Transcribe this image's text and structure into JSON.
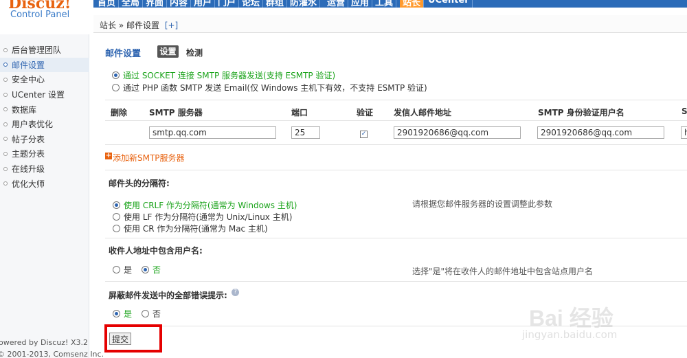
{
  "logo": {
    "brand": "Discuz!",
    "subtitle": "Control Panel"
  },
  "topnav": [
    {
      "label": "首页"
    },
    {
      "label": "全局"
    },
    {
      "label": "界面"
    },
    {
      "label": "内容"
    },
    {
      "label": "用户"
    },
    {
      "label": "门户"
    },
    {
      "label": "论坛"
    },
    {
      "label": "群组"
    },
    {
      "label": "防灌水"
    },
    {
      "label": "运营"
    },
    {
      "label": "应用"
    },
    {
      "label": "工具"
    },
    {
      "label": "站长"
    },
    {
      "label": "UCenter"
    }
  ],
  "breadcrumb": {
    "text": "站长 » 邮件设置",
    "add": "[+]"
  },
  "sidebar": {
    "items": [
      {
        "label": "后台管理团队"
      },
      {
        "label": "邮件设置"
      },
      {
        "label": "安全中心"
      },
      {
        "label": "UCenter 设置"
      },
      {
        "label": "数据库"
      },
      {
        "label": "用户表优化"
      },
      {
        "label": "帖子分表"
      },
      {
        "label": "主题分表"
      },
      {
        "label": "在线升级"
      },
      {
        "label": "优化大师"
      }
    ],
    "footer_powered": "owered by Discuz! X3.2",
    "footer_copy": "© 2001-2013, Comsenz Inc."
  },
  "main": {
    "title": "邮件设置",
    "tab_settings": "设置",
    "tab_check": "检测",
    "send_mode": {
      "option1": "通过 SOCKET 连接 SMTP 服务器发送(支持 ESMTP 验证)",
      "option2": "通过 PHP 函数 SMTP 发送 Email(仅 Windows 主机下有效，不支持 ESMTP 验证)"
    },
    "table": {
      "headers": {
        "delete": "删除",
        "server": "SMTP 服务器",
        "port": "端口",
        "auth": "验证",
        "from": "发信人邮件地址",
        "user": "SMTP 身份验证用户名",
        "more": "S"
      },
      "row": {
        "server": "smtp.qq.com",
        "port": "25",
        "from": "2901920686@qq.com",
        "user": "2901920686@qq.com",
        "more": "h"
      }
    },
    "add_server": "添加新SMTP服务器",
    "separator": {
      "title": "邮件头的分隔符:",
      "opt1": "使用 CRLF 作为分隔符(通常为 Windows 主机)",
      "opt2": "使用 LF 作为分隔符(通常为 Unix/Linux 主机)",
      "opt3": "使用 CR 作为分隔符(通常为 Mac 主机)",
      "hint": "请根据您邮件服务器的设置调整此参数"
    },
    "include_user": {
      "title": "收件人地址中包含用户名:",
      "yes": "是",
      "no": "否",
      "hint": "选择\"是\"将在收件人的邮件地址中包含站点用户名"
    },
    "silent": {
      "title": "屏蔽邮件发送中的全部错误提示:",
      "help_icon": "?",
      "yes": "是",
      "no": "否"
    },
    "submit": "提交"
  },
  "watermark": {
    "text": "Bai 经验",
    "sub": "jingyan.baidu.com"
  },
  "colors": {
    "accent": "#2e64b0",
    "highlight_box": "#e50000",
    "topbar": "#2b6bb8"
  }
}
